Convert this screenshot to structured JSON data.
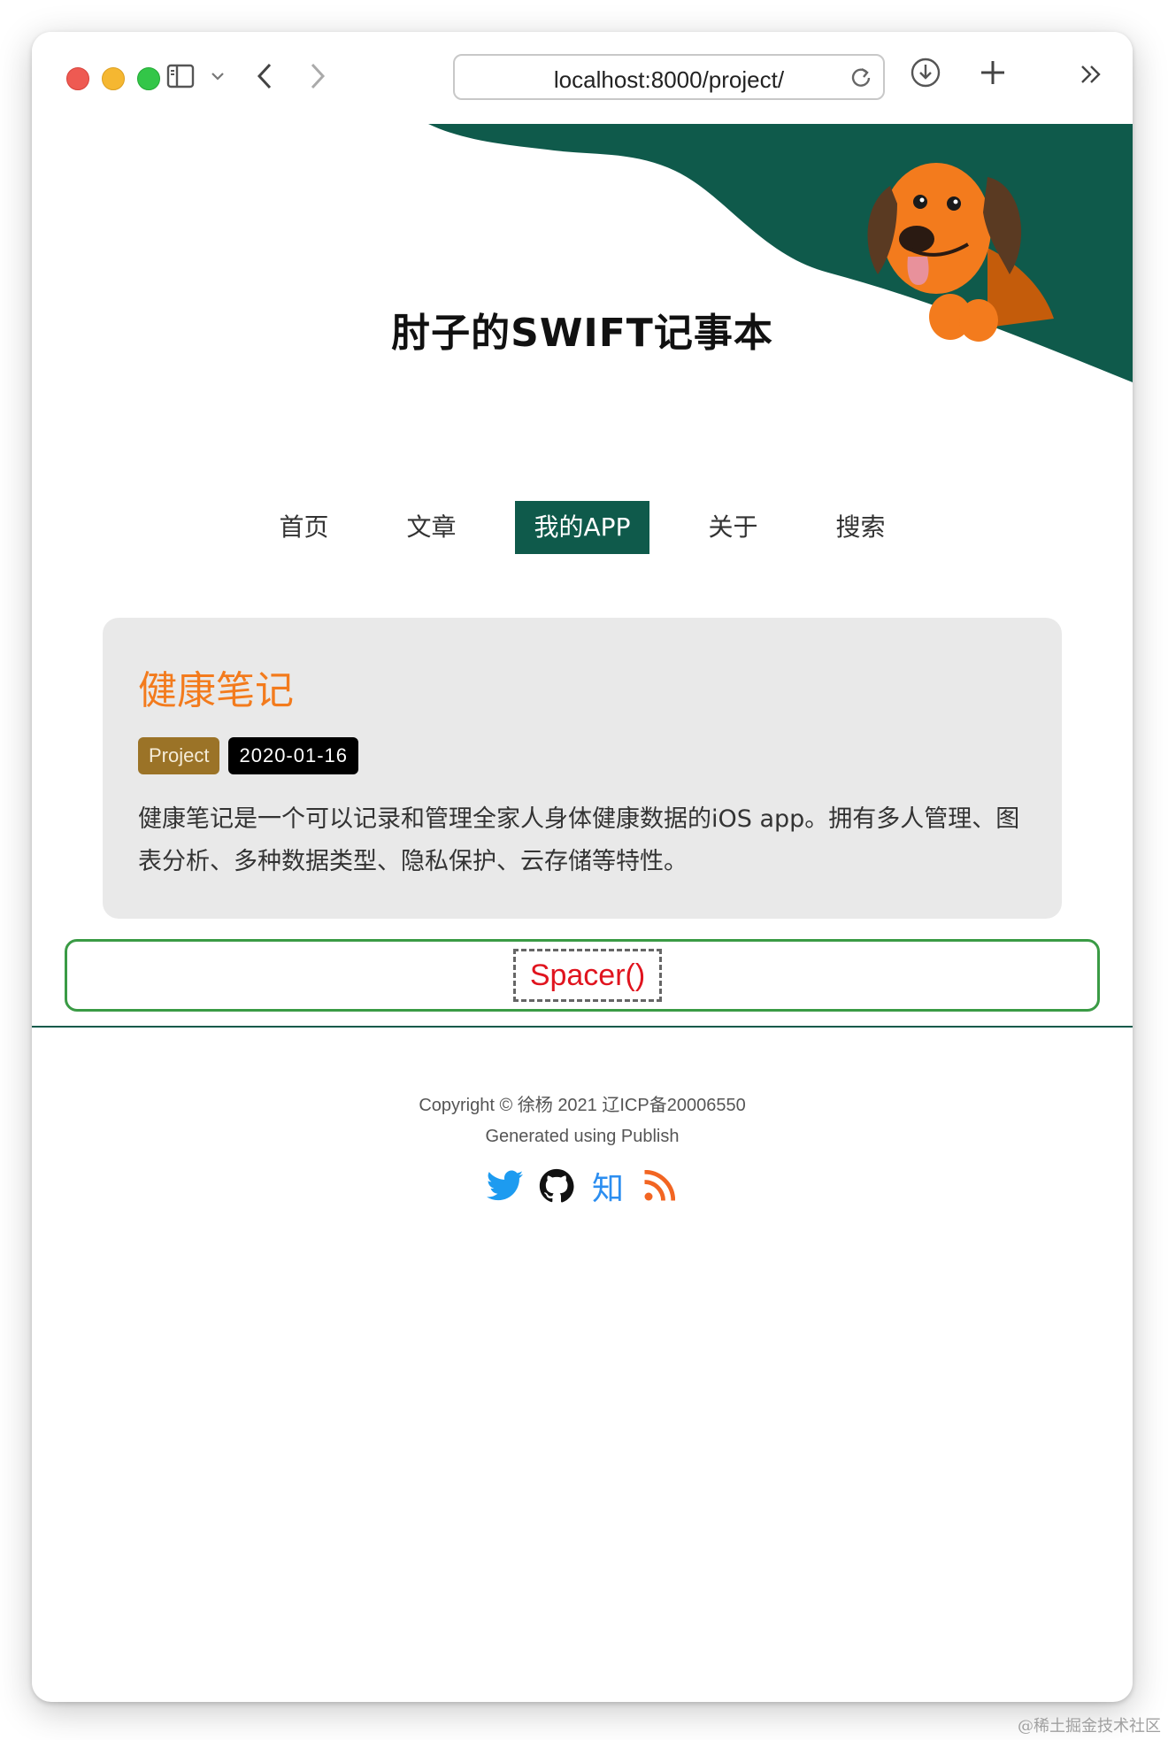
{
  "browser": {
    "url": "localhost:8000/project/"
  },
  "site": {
    "title": "肘子的SWIFT记事本"
  },
  "nav": {
    "items": [
      {
        "label": "首页"
      },
      {
        "label": "文章"
      },
      {
        "label": "我的APP",
        "active": true
      },
      {
        "label": "关于"
      },
      {
        "label": "搜索"
      }
    ]
  },
  "project": {
    "title": "健康笔记",
    "tag": "Project",
    "date": "2020-01-16",
    "description": "健康笔记是一个可以记录和管理全家人身体健康数据的iOS app。拥有多人管理、图表分析、多种数据类型、隐私保护、云存储等特性。"
  },
  "annotation": {
    "spacer_label": "Spacer()"
  },
  "footer": {
    "copyright": "Copyright © 徐杨 2021 辽ICP备20006550",
    "generated": "Generated using Publish",
    "social_icons": [
      "twitter-icon",
      "github-icon",
      "zhihu-icon",
      "rss-icon"
    ],
    "zhihu_text": "知"
  },
  "watermark": "@稀土掘金技术社区",
  "colors": {
    "accent_green": "#0f5a4b",
    "title_orange": "#f37b1d",
    "tag_brown": "#9b7327",
    "spacer_red": "#e0141e",
    "spacer_border_green": "#3a9b45"
  }
}
